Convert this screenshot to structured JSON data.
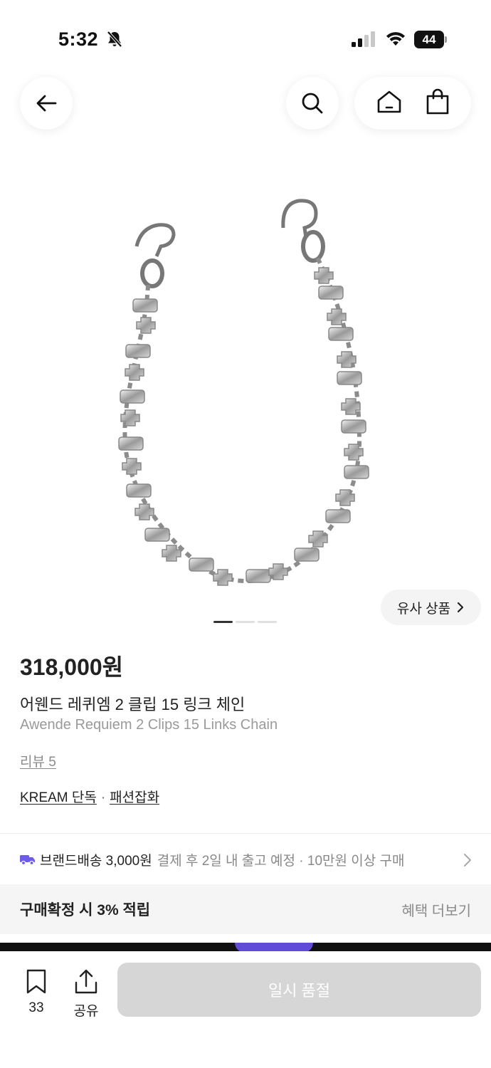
{
  "status_bar": {
    "time": "5:32",
    "battery": "44"
  },
  "header": {
    "icons": [
      "arrow-left-icon",
      "search-icon",
      "home-icon",
      "shopping-bag-icon"
    ]
  },
  "gallery": {
    "image_count": 3,
    "active_index": 0,
    "similar_label": "유사 상품"
  },
  "product": {
    "price": "318,000원",
    "name_ko": "어웬드 레퀴엠 2 클립 15 링크 체인",
    "name_en": "Awende Requiem 2 Clips 15 Links Chain",
    "reviews": "리뷰 5",
    "tag_exclusive": "KREAM 단독",
    "tag_separator": "·",
    "tag_category": "패션잡화"
  },
  "shipping": {
    "label": "브랜드배송 3,000원",
    "detail": "결제 후 2일 내 출고 예정 · 10만원 이상 구매",
    "accent_color": "#6c5ce7"
  },
  "benefit": {
    "title": "구매확정 시 3% 적립",
    "more": "혜택 더보기"
  },
  "bottom_bar": {
    "bookmark_count": "33",
    "share_label": "공유",
    "buy_label": "일시 품절",
    "buy_color": "#d6d6d6"
  }
}
